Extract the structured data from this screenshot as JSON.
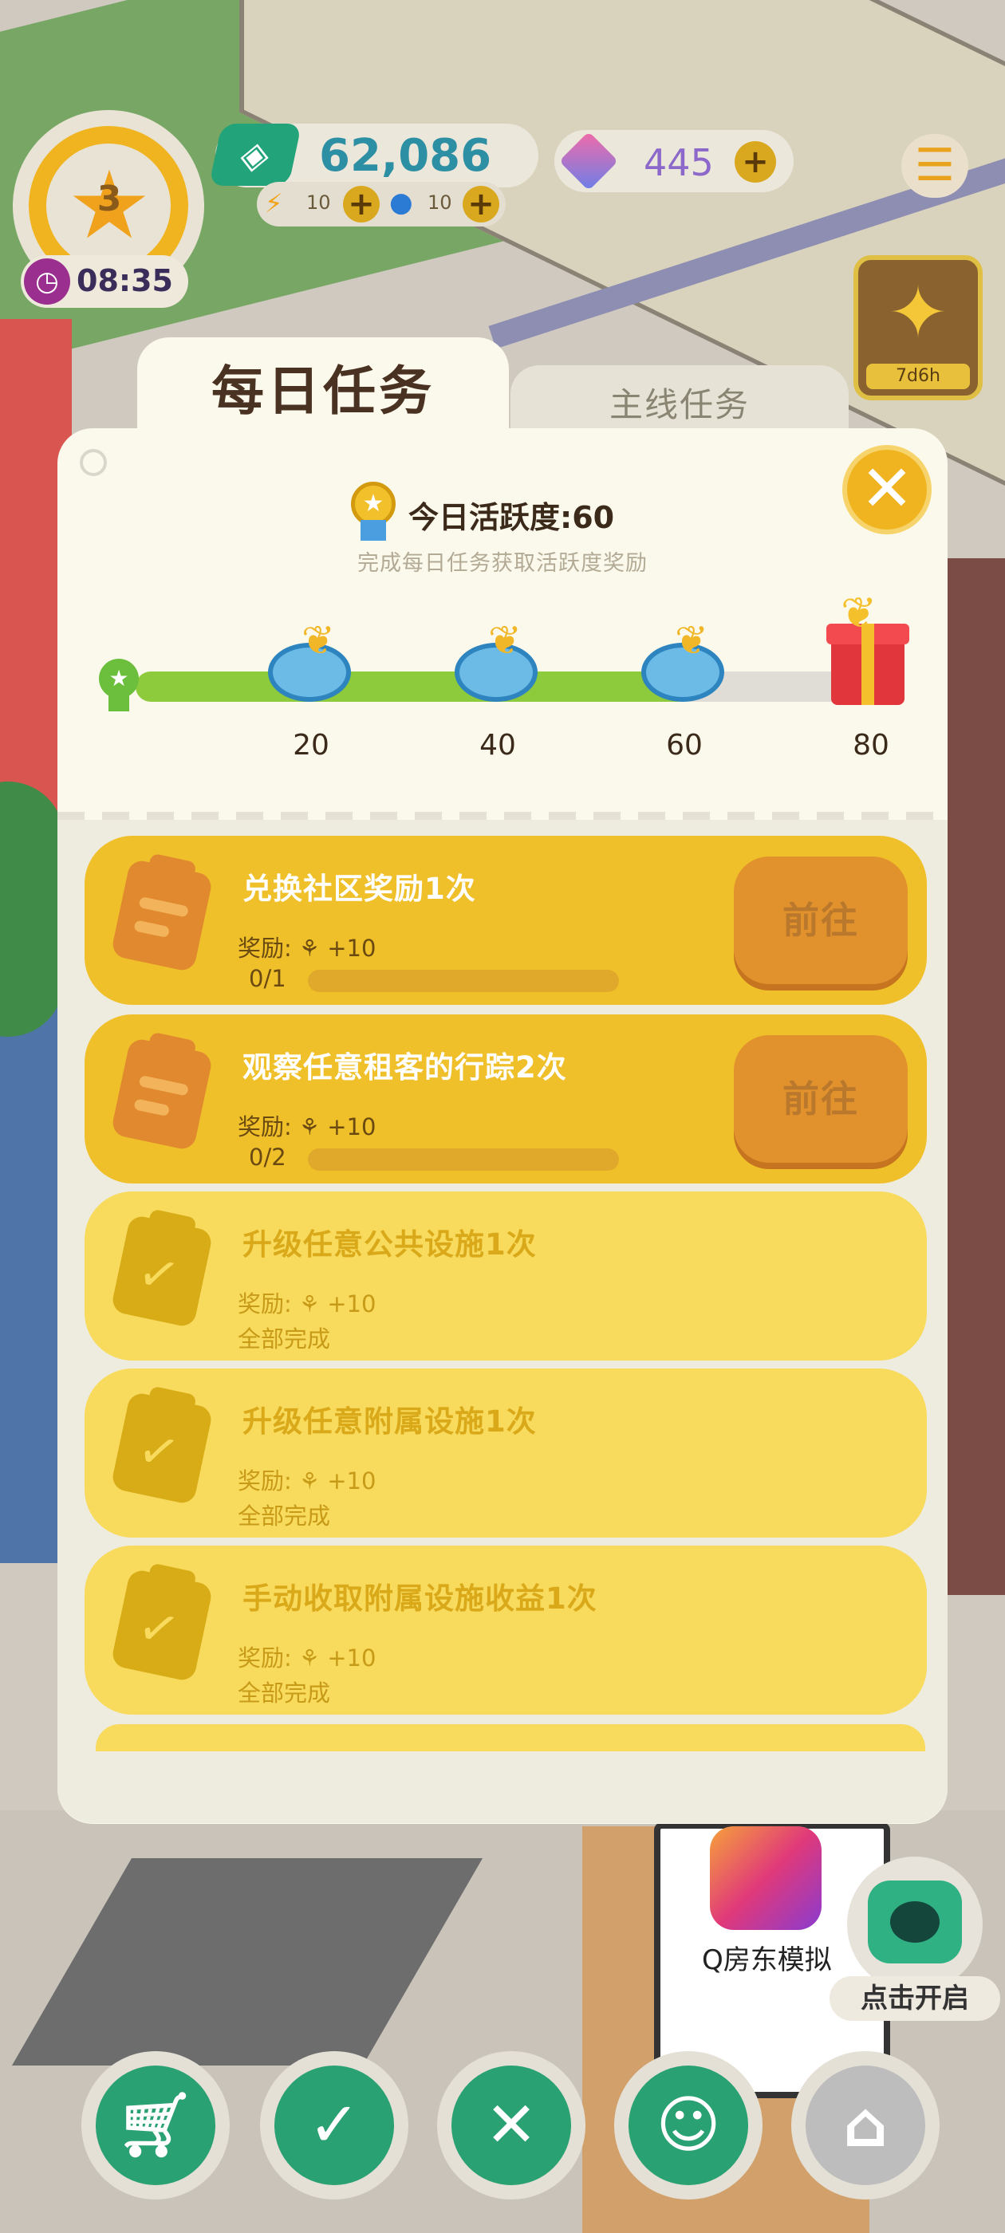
{
  "hud": {
    "level": "3",
    "timer": "08:35",
    "money": "62,086",
    "energy_bolt": "10",
    "energy_water": "10",
    "gems": "445",
    "event_timer": "7d6h"
  },
  "tabs": {
    "daily": "每日任务",
    "main": "主线任务"
  },
  "activity": {
    "title": "今日活跃度:60",
    "subtitle": "完成每日任务获取活跃度奖励",
    "progress_value": 60,
    "progress_max": 80,
    "milestones": [
      "20",
      "40",
      "60",
      "80"
    ]
  },
  "tasks": [
    {
      "title": "兑换社区奖励1次",
      "reward": "奖励: ⚘ +10",
      "status": "0/1",
      "button": "前往",
      "state": "active"
    },
    {
      "title": "观察任意租客的行踪2次",
      "reward": "奖励: ⚘ +10",
      "status": "0/2",
      "button": "前往",
      "state": "active"
    },
    {
      "title": "升级任意公共设施1次",
      "reward": "奖励: ⚘ +10",
      "status": "全部完成",
      "state": "done"
    },
    {
      "title": "升级任意附属设施1次",
      "reward": "奖励: ⚘ +10",
      "status": "全部完成",
      "state": "done"
    },
    {
      "title": "手动收取附属设施收益1次",
      "reward": "奖励: ⚘ +10",
      "status": "全部完成",
      "state": "done"
    }
  ],
  "widget": {
    "label": "点击开启"
  },
  "background": {
    "sign_text": "Q房东模拟"
  },
  "colors": {
    "accent_yellow": "#f0c02a",
    "done_yellow": "#f8da5c",
    "progress_green": "#8ecb3c",
    "nav_green": "#2aa173"
  }
}
